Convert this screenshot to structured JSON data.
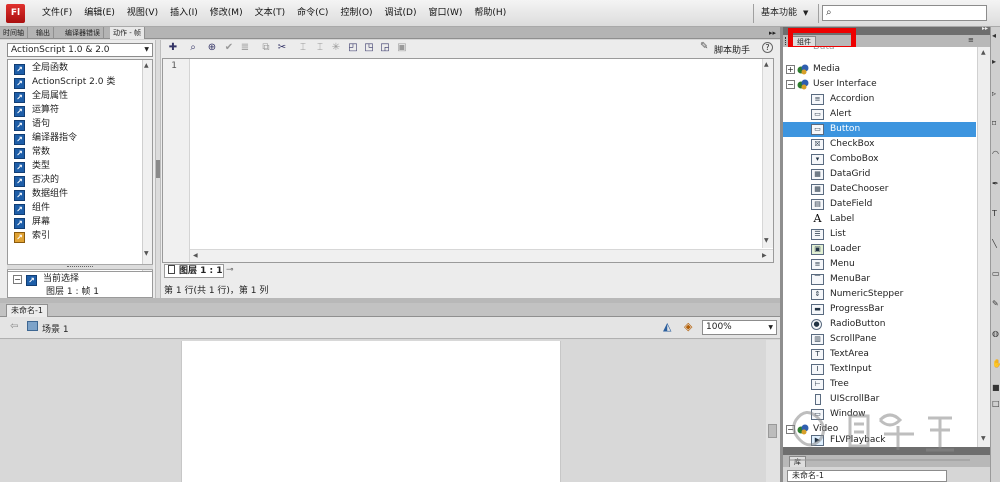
{
  "app": {
    "logo": "Fl"
  },
  "menu": [
    "文件(F)",
    "编辑(E)",
    "视图(V)",
    "插入(I)",
    "修改(M)",
    "文本(T)",
    "命令(C)",
    "控制(O)",
    "调试(D)",
    "窗口(W)",
    "帮助(H)"
  ],
  "workspace": {
    "label": "基本功能",
    "arrow": "▼"
  },
  "search": {
    "value": "",
    "placeholder": ""
  },
  "panel_tabs": [
    "时间轴",
    "输出",
    "编译器错误",
    "动作 - 帧"
  ],
  "actions": {
    "language": "ActionScript 1.0 & 2.0",
    "toolbox": [
      "全局函数",
      "ActionScript 2.0 类",
      "全局属性",
      "运算符",
      "语句",
      "编译器指令",
      "常数",
      "类型",
      "否决的",
      "数据组件",
      "组件",
      "屏幕",
      "索引"
    ],
    "script_nav": {
      "current_selection": "当前选择",
      "layer_frame": "图层 1 : 帧 1"
    },
    "script_assist": "脚本助手",
    "line_number": "1",
    "layer_tab": "图层 1 : 1",
    "status": "第 1 行(共 1 行)，第 1 列"
  },
  "document": {
    "tab": "未命名-1",
    "scene": "场景 1",
    "zoom": "100%"
  },
  "components_panel": {
    "tab": "组件",
    "folders": {
      "media": "Media",
      "ui": "User Interface",
      "video": "Video"
    },
    "partial_top": "Data",
    "items": [
      "Accordion",
      "Alert",
      "Button",
      "CheckBox",
      "ComboBox",
      "DataGrid",
      "DateChooser",
      "DateField",
      "Label",
      "List",
      "Loader",
      "Menu",
      "MenuBar",
      "NumericStepper",
      "ProgressBar",
      "RadioButton",
      "ScrollPane",
      "TextArea",
      "TextInput",
      "Tree",
      "UIScrollBar",
      "Window"
    ],
    "video_items": [
      "FLVPlayback"
    ],
    "selected": "Button"
  },
  "library_panel": {
    "tab": "库",
    "document": "未命名-1"
  },
  "colors": {
    "selection": "#3d95df",
    "highlight": "#ee0000",
    "logo": "#c62121"
  }
}
